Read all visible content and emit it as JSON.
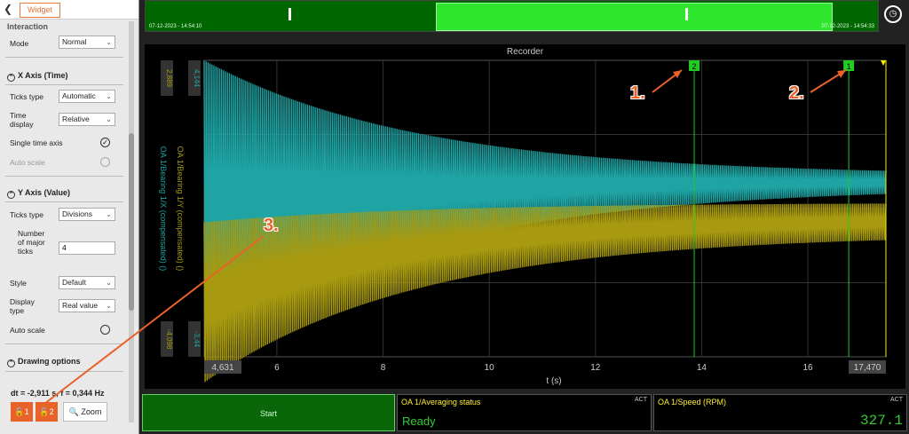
{
  "panel": {
    "back_icon": "chevron-left-icon",
    "tab_label": "Widget",
    "cut_section": "Interaction",
    "mode_label": "Mode",
    "mode_value": "Normal",
    "x_axis_title": "X Axis (Time)",
    "x_ticks_type_label": "Ticks type",
    "x_ticks_type_value": "Automatic",
    "time_display_label": "Time display",
    "time_display_value": "Relative",
    "single_time_axis_label": "Single time axis",
    "single_time_axis_checked": true,
    "x_auto_scale_label": "Auto scale",
    "y_axis_title": "Y Axis (Value)",
    "y_ticks_type_label": "Ticks type",
    "y_ticks_type_value": "Divisions",
    "major_ticks_label": "Number of major ticks",
    "major_ticks_value": "4",
    "style_label": "Style",
    "style_value": "Default",
    "display_type_label": "Display type",
    "display_type_value": "Real value",
    "y_auto_scale_label": "Auto scale",
    "drawing_options_title": "Drawing options",
    "dt_text": "dt = -2,911 s, f = 0,344 Hz",
    "lock1_label": "1",
    "lock2_label": "2",
    "zoom_label": "Zoom"
  },
  "timeline": {
    "start_ts": "07-12-2023 - 14:54:10",
    "end_ts": "07-12-2023 - 14:54:33",
    "clock_icon": "clock-icon"
  },
  "colors": {
    "teal": "#1fa3a3",
    "olive": "#a89a10",
    "cursor": "#22cc22",
    "accent": "#e8622a"
  },
  "chart_data": {
    "type": "line",
    "title": "Recorder",
    "xlabel": "t (s)",
    "x_ticks": [
      "4,631",
      "6",
      "8",
      "10",
      "12",
      "14",
      "16",
      "17,470"
    ],
    "xlim": [
      4.631,
      17.47
    ],
    "y_left_label": "OA 1/Bearing 1/X (compensated) ()",
    "y_left_top": "4,144",
    "y_left_bottom": "-3,44",
    "y_right_label": "OA 1/Bearing 1/Y (compensated) ()",
    "y_right_top": "2,889",
    "y_right_bottom": "-4,098",
    "series": [
      {
        "name": "OA 1/Bearing 1/X (compensated) ()",
        "color": "#1fa3a3",
        "envelope_upper_start": 4.144,
        "envelope_upper_end": 1.2,
        "envelope_lower_start": -3.44,
        "envelope_lower_end": 0.9
      },
      {
        "name": "OA 1/Bearing 1/Y (compensated) ()",
        "color": "#a89a10",
        "envelope_upper_start": 0.0,
        "envelope_upper_end": 0.5,
        "envelope_lower_start": -4.098,
        "envelope_lower_end": -0.3
      }
    ],
    "cursors": [
      {
        "label": "2",
        "x": 13.86
      },
      {
        "label": "1",
        "x": 16.77
      }
    ]
  },
  "bottom": {
    "start_label": "Start",
    "averaging_title": "OA 1/Averaging status",
    "averaging_act": "ACT",
    "averaging_value": "Ready",
    "speed_title": "OA 1/Speed (RPM)",
    "speed_act": "ACT",
    "speed_value": "327.1"
  },
  "annotations": [
    "1.",
    "2.",
    "3."
  ]
}
